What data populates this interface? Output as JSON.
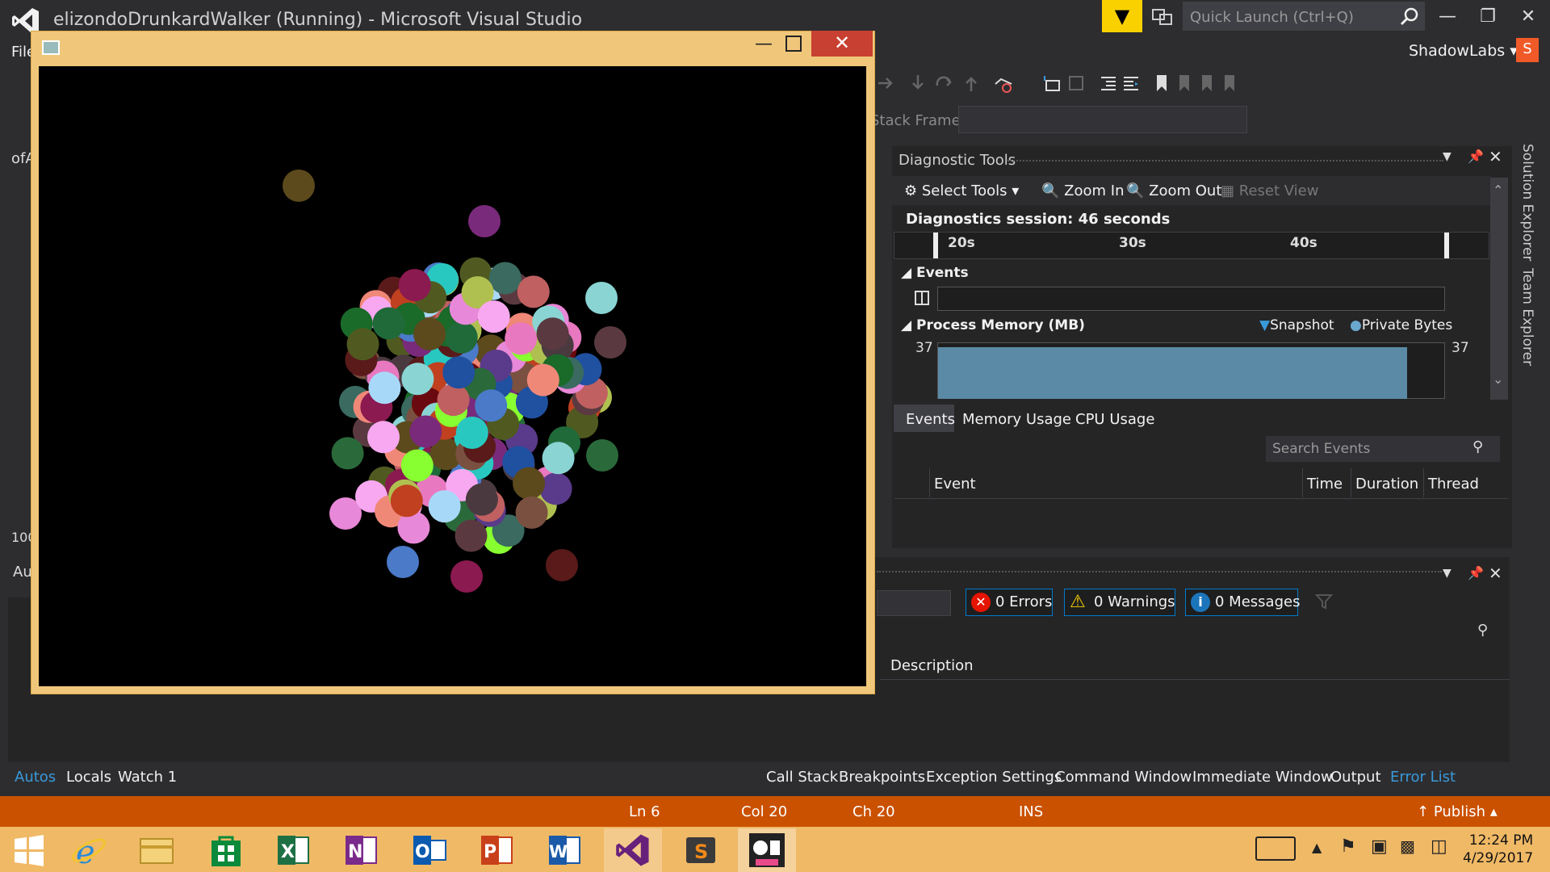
{
  "window": {
    "title": "elizondoDrunkardWalker (Running) - Microsoft Visual Studio",
    "quick_launch_placeholder": "Quick Launch (Ctrl+Q)",
    "user": "ShadowLabs",
    "user_initial": "S"
  },
  "menu": {
    "file": "File"
  },
  "toolbar": {
    "stack_frame_label": "Stack Frame:"
  },
  "left_panel": {
    "ofa": "ofA",
    "zoom": "100",
    "autos_short": "Au"
  },
  "diagnostic_tools": {
    "title": "Diagnostic Tools",
    "select_tools": "Select Tools",
    "zoom_in": "Zoom In",
    "zoom_out": "Zoom Out",
    "reset_view": "Reset View",
    "session": "Diagnostics session: 46 seconds",
    "ticks": [
      "20s",
      "30s",
      "40s"
    ],
    "events_header": "Events",
    "process_memory_header": "Process Memory (MB)",
    "legend_snapshot": "Snapshot",
    "legend_private_bytes": "Private Bytes",
    "memory_min": "37",
    "memory_max": "37",
    "tabs": [
      "Events",
      "Memory Usage",
      "CPU Usage"
    ],
    "search_placeholder": "Search Events",
    "columns": [
      "Event",
      "Time",
      "Duration",
      "Thread"
    ]
  },
  "error_list": {
    "errors": "0 Errors",
    "warnings": "0 Warnings",
    "messages": "0 Messages",
    "description_header": "Description"
  },
  "bottom_tabs_left": [
    "Autos",
    "Locals",
    "Watch 1"
  ],
  "bottom_tabs_right": [
    "Call Stack",
    "Breakpoints",
    "Exception Settings",
    "Command Window",
    "Immediate Window",
    "Output",
    "Error List"
  ],
  "side_tabs": [
    "Solution Explorer",
    "Team Explorer"
  ],
  "status": {
    "line": "Ln 6",
    "col": "Col 20",
    "ch": "Ch 20",
    "mode": "INS",
    "publish": "Publish"
  },
  "taskbar": {
    "apps": [
      "start-icon",
      "internet-explorer-icon",
      "file-explorer-icon",
      "store-icon",
      "excel-icon",
      "onenote-icon",
      "outlook-icon",
      "powerpoint-icon",
      "word-icon",
      "visual-studio-icon",
      "sublime-icon",
      "openframeworks-icon"
    ],
    "time": "12:24 PM",
    "date": "4/29/2017"
  },
  "colors": {
    "accent": "#007acc",
    "status_bar": "#ca5100",
    "taskbar": "#f0b966",
    "vs_filter": "#f9d100"
  },
  "app_window": {
    "canvas_background": "#000000",
    "dot_palette": [
      "#5c4a1c",
      "#7a2a7a",
      "#8ad4d4",
      "#5a3a40",
      "#b0c050",
      "#2a6a3a",
      "#e888d8",
      "#4a7ac8",
      "#88ff30",
      "#8a1a50",
      "#5a1a1a",
      "#1a6a2a",
      "#28c8c0",
      "#c06060",
      "#f8a8f0",
      "#2050a0",
      "#c04020",
      "#f08878",
      "#505a20",
      "#3a6a60",
      "#7a5040",
      "#6a0a10",
      "#4a3a40",
      "#206a3a",
      "#a8d8f8",
      "#e878c0",
      "#5a3a8a"
    ]
  }
}
